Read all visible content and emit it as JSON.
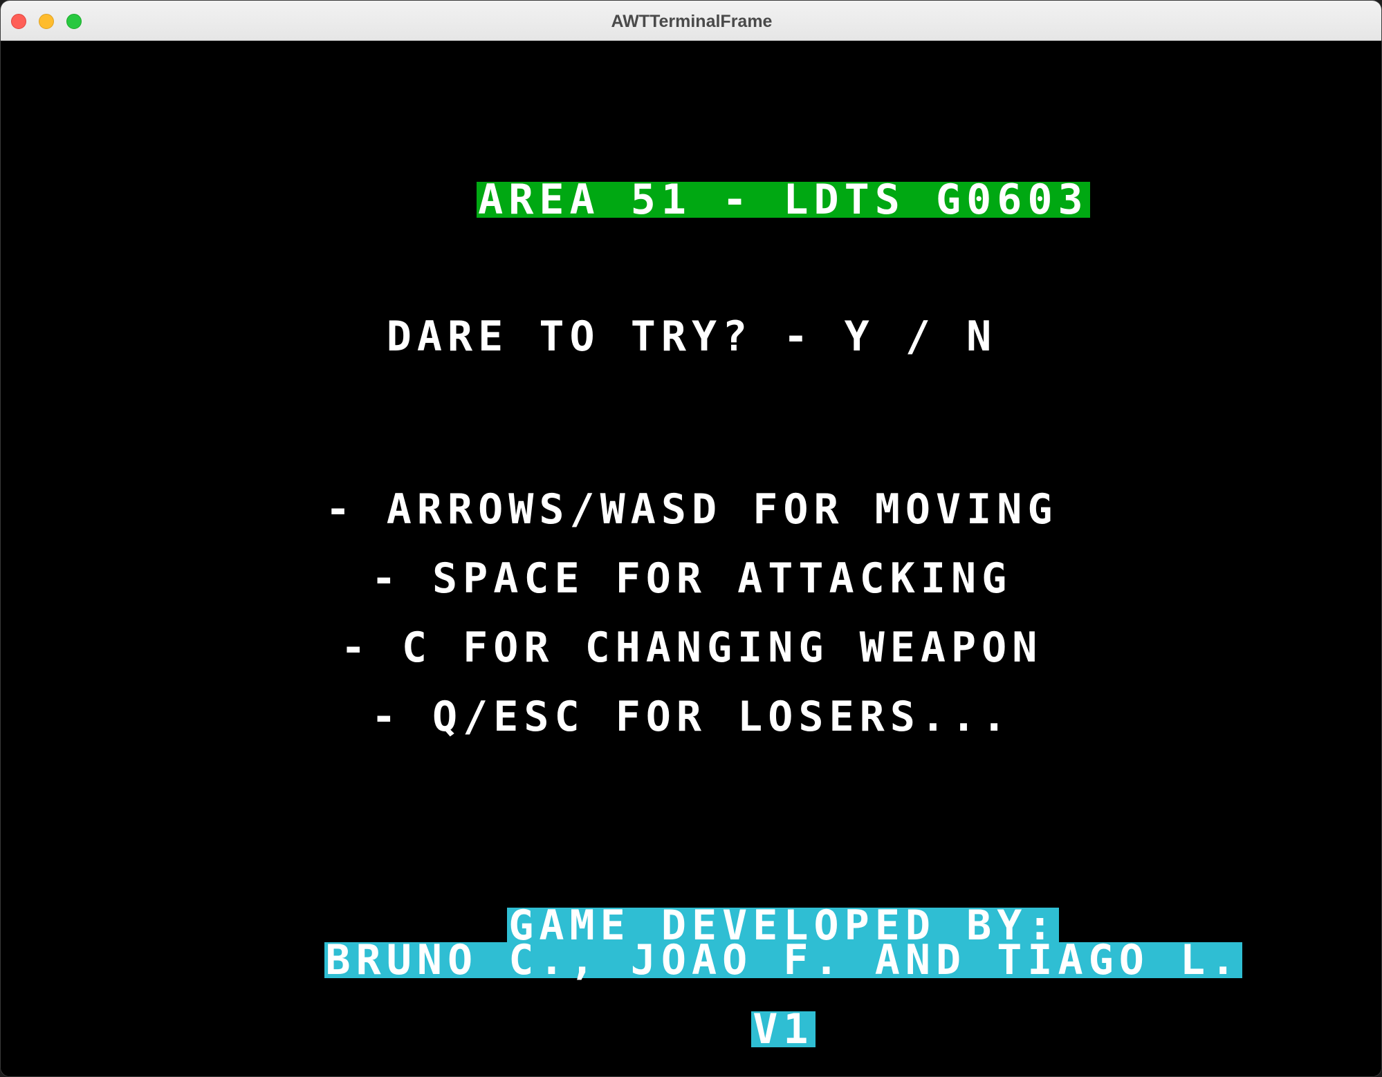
{
  "window": {
    "title": "AWTTerminalFrame"
  },
  "screen": {
    "heading": "AREA 51 - LDTS G0603",
    "prompt": "DARE TO TRY? - Y / N",
    "instructions": [
      "- ARROWS/WASD FOR MOVING",
      "- SPACE FOR ATTACKING",
      "- C FOR CHANGING WEAPON",
      "- Q/ESC FOR LOSERS..."
    ],
    "credits_line1": "GAME DEVELOPED BY:",
    "credits_line2": "BRUNO C., JOAO F. AND TIAGO L.",
    "version": "V1"
  },
  "colors": {
    "background": "#000000",
    "text": "#ffffff",
    "heading_highlight": "#00a812",
    "credits_highlight": "#2fbed3"
  }
}
